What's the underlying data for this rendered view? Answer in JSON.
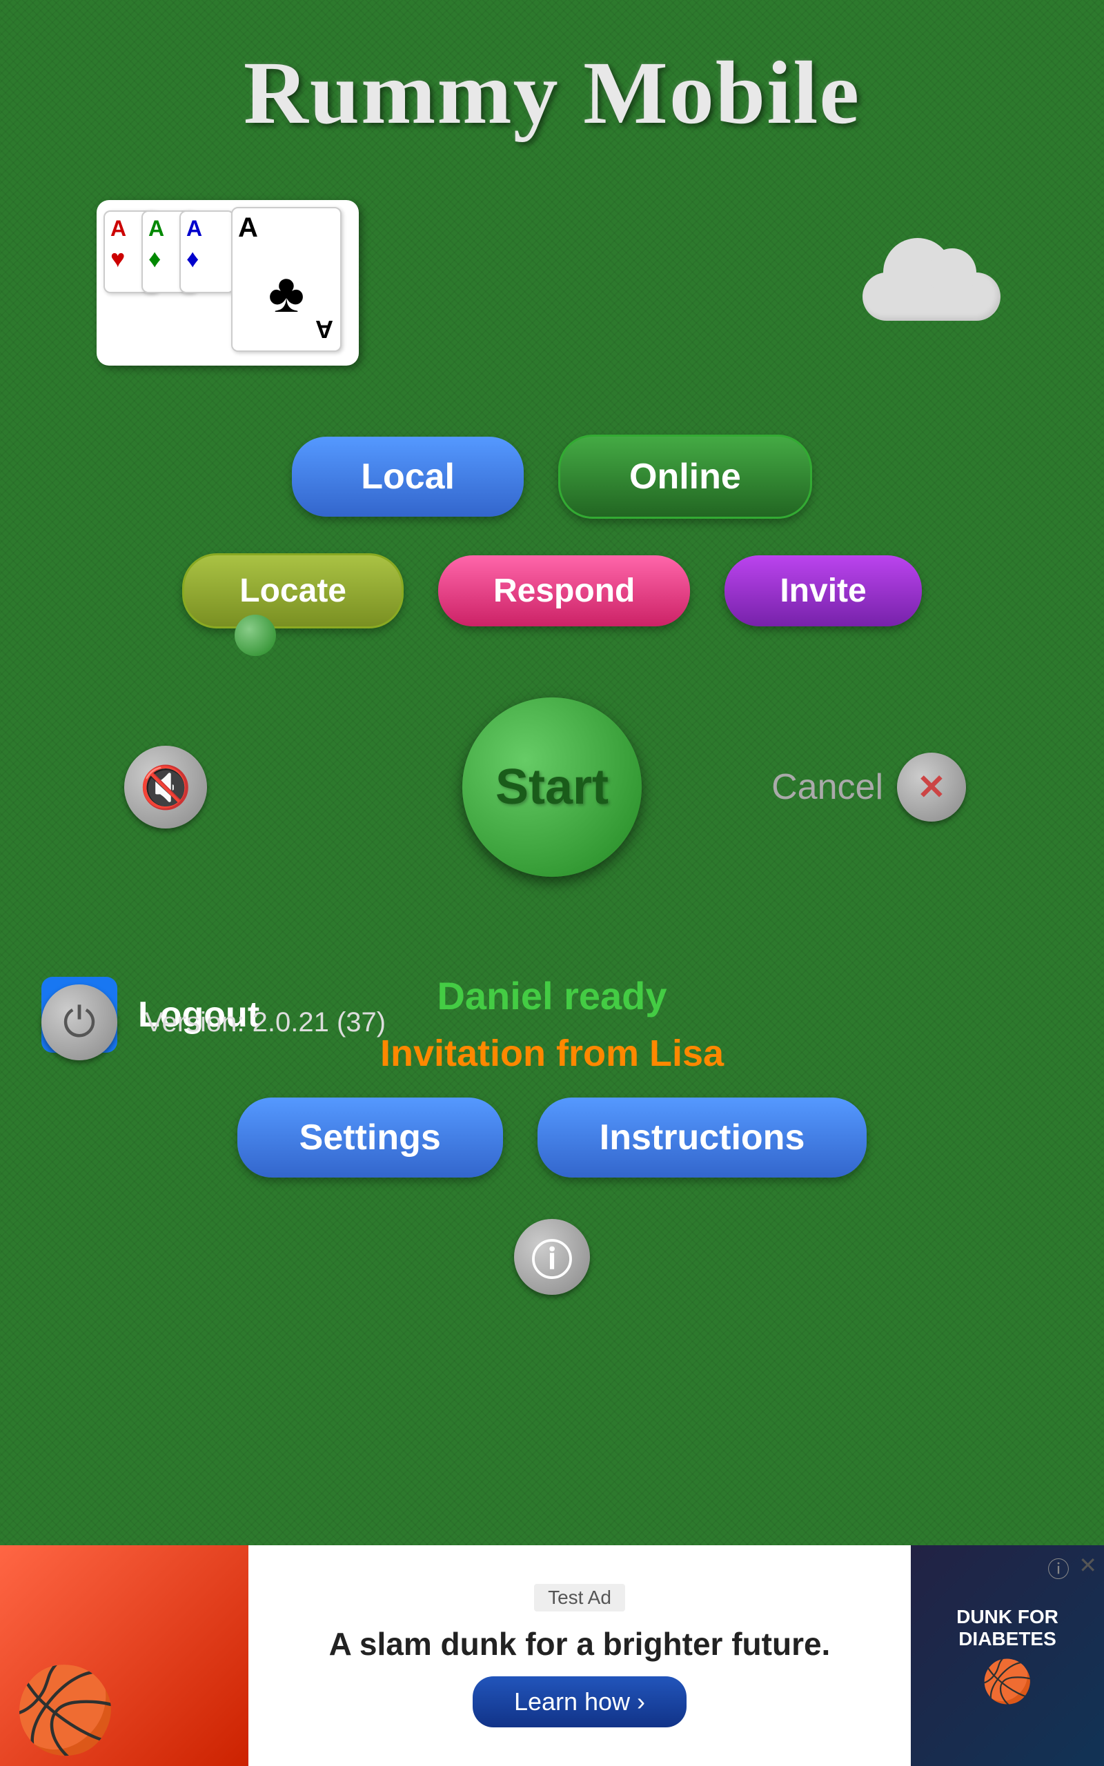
{
  "app": {
    "title": "Rummy Mobile"
  },
  "cards": {
    "items": [
      {
        "letter": "A",
        "color": "red",
        "suit": "♥"
      },
      {
        "letter": "A",
        "color": "green-card",
        "suit": "♦"
      },
      {
        "letter": "A",
        "color": "blue",
        "suit": "♦"
      },
      {
        "letter": "A",
        "color": "black",
        "suit": "♣",
        "bottom": "A"
      }
    ]
  },
  "buttons": {
    "local": "Local",
    "online": "Online",
    "locate": "Locate",
    "respond": "Respond",
    "invite": "Invite",
    "start": "Start",
    "cancel": "Cancel",
    "logout": "Logout",
    "settings": "Settings",
    "instructions": "Instructions"
  },
  "status": {
    "player_ready": "Daniel ready",
    "invitation": "Invitation from Lisa"
  },
  "version": {
    "text": "Version: 2.0.21 (37)"
  },
  "ad": {
    "test_label": "Test Ad",
    "tagline": "A slam dunk for a brighter future.",
    "learn_btn": "Learn how ›",
    "badge": "DUNK FOR DIABETES"
  }
}
